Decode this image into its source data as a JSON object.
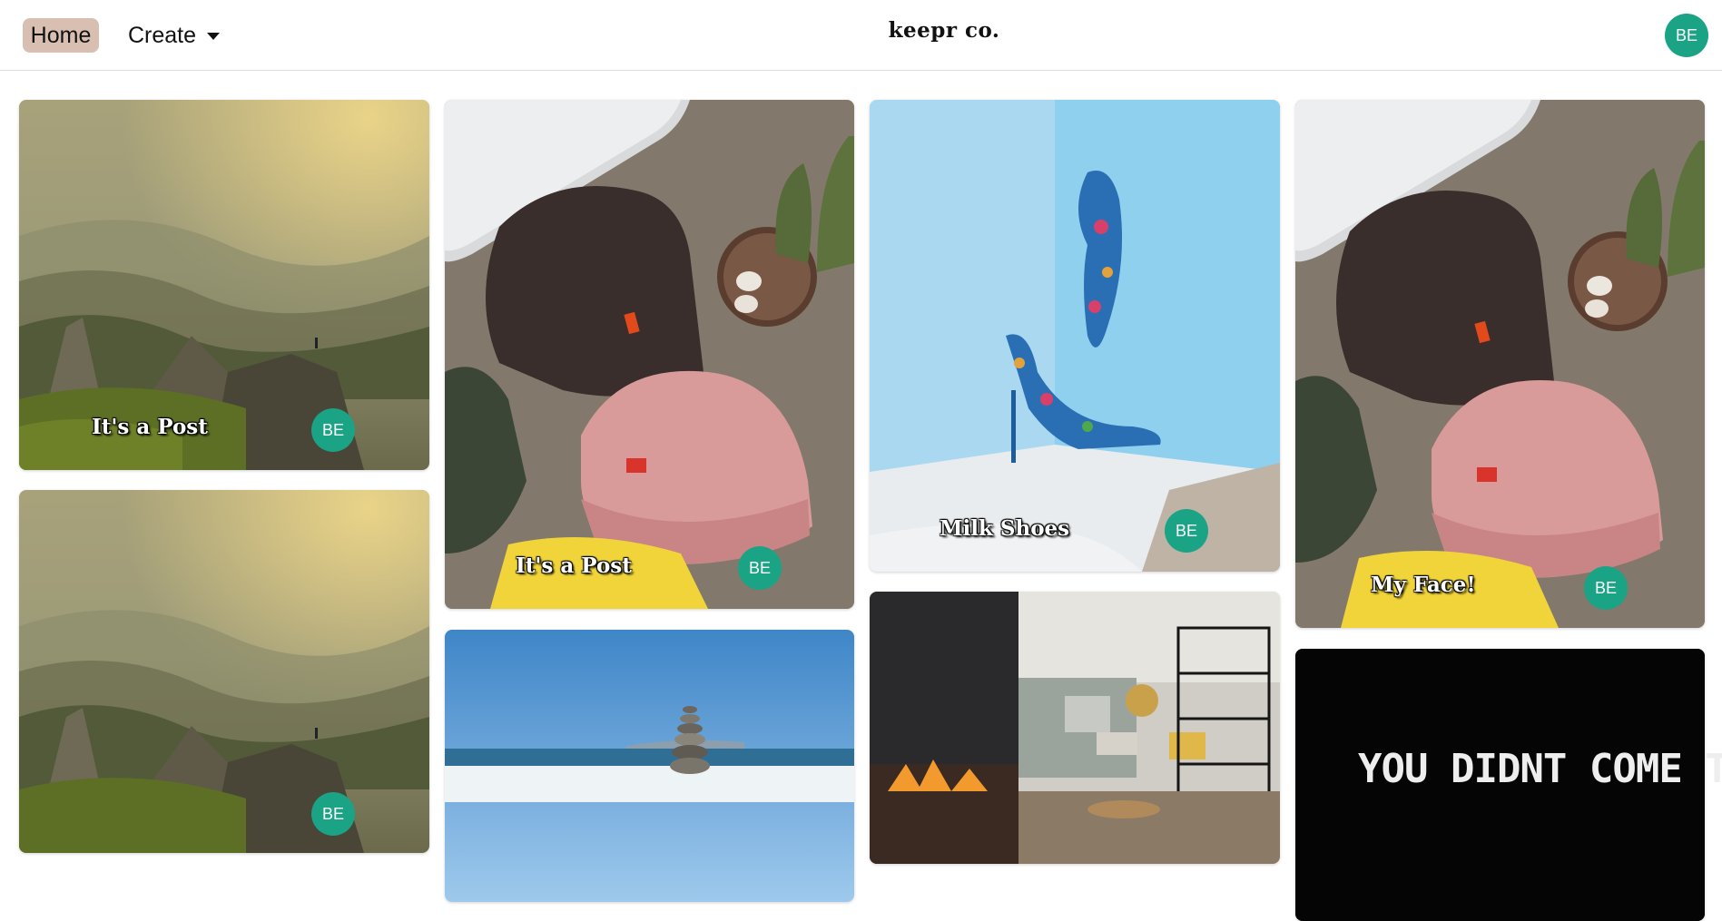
{
  "nav": {
    "home_label": "Home",
    "create_label": "Create",
    "brand": "keepr co.",
    "user_initials": "BE"
  },
  "cards": [
    {
      "title": "It's a Post",
      "author": "BE",
      "image": "mountain-landscape"
    },
    {
      "title": "It's a Post",
      "author": "BE",
      "image": "beanies-flatlay"
    },
    {
      "title": "Milk Shoes",
      "author": "BE",
      "image": "floral-heels"
    },
    {
      "title": "My Face!",
      "author": "BE",
      "image": "beanies-flatlay"
    },
    {
      "title": "",
      "author": "BE",
      "image": "mountain-landscape"
    },
    {
      "title": "",
      "author": "",
      "image": "stacked-stones-beach"
    },
    {
      "title": "",
      "author": "",
      "image": "living-room-interior"
    },
    {
      "title": "",
      "author": "",
      "image": "meme-text",
      "banner_text": "YOU DIDNT COME THIS"
    }
  ],
  "colors": {
    "accent_avatar": "#1aa385",
    "home_pill": "#d8bfb2"
  }
}
